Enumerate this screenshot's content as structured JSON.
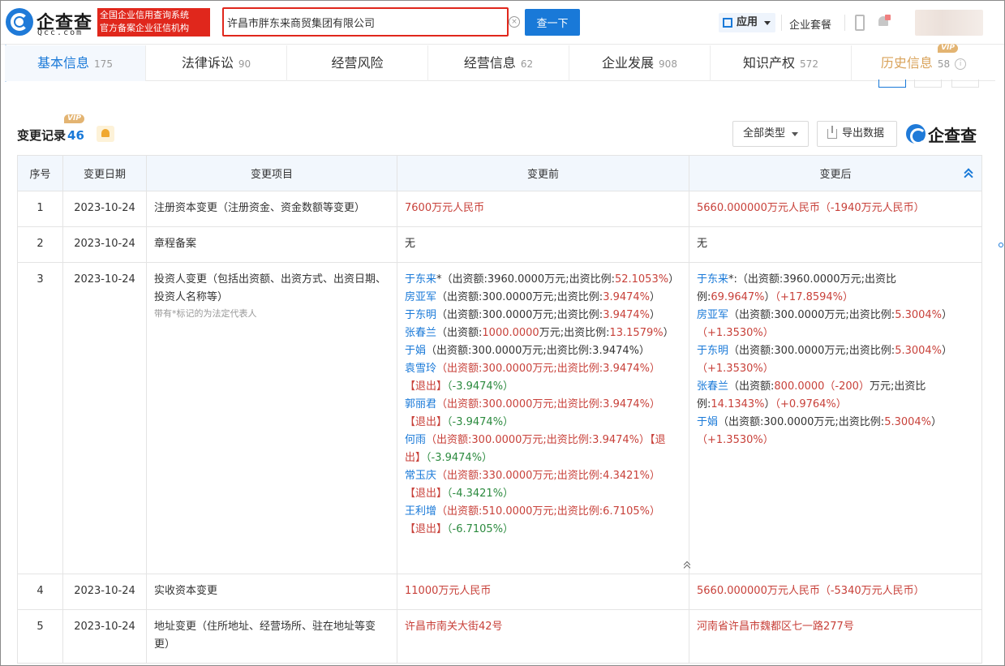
{
  "header": {
    "logo_name": "企查查",
    "logo_sub": "Qcc.com",
    "badge_line1": "全国企业信用查询系统",
    "badge_line2": "官方备案企业征信机构",
    "search_value": "许昌市胖东来商贸集团有限公司",
    "search_button": "查一下",
    "clear_symbol": "×",
    "apps_label": "应用",
    "packages_label": "企业套餐"
  },
  "tabs": [
    {
      "label": "基本信息",
      "count": "175"
    },
    {
      "label": "法律诉讼",
      "count": "90"
    },
    {
      "label": "经营风险",
      "count": ""
    },
    {
      "label": "经营信息",
      "count": "62"
    },
    {
      "label": "企业发展",
      "count": "908"
    },
    {
      "label": "知识产权",
      "count": "572"
    },
    {
      "label": "历史信息",
      "count": "58",
      "vip": "VIP",
      "info": "i"
    }
  ],
  "section": {
    "title": "变更记录",
    "count": "46",
    "vip": "VIP",
    "type_filter": "全部类型",
    "export": "导出数据",
    "brand": "企查查"
  },
  "table": {
    "headers": [
      "序号",
      "变更日期",
      "变更项目",
      "变更前",
      "变更后"
    ],
    "rows": [
      {
        "no": "1",
        "date": "2023-10-24",
        "item": "注册资本变更（注册资金、资金数额等变更）",
        "before": "7600万元人民币",
        "after": "5660.000000万元人民币（-1940万元人民币）"
      },
      {
        "no": "2",
        "date": "2023-10-24",
        "item": "章程备案",
        "before": "无",
        "after": "无"
      },
      {
        "no": "3",
        "date": "2023-10-24",
        "item": "投资人变更（包括出资额、出资方式、出资日期、投资人名称等）",
        "note": "带有*标记的为法定代表人",
        "before": {
          "p1_name": "于东来",
          "p1_a": "*（出资额:3960.0000万元;出资比例:",
          "p1_b": "52.1053%",
          "p1_c": "）",
          "p2_name": "房亚军",
          "p2_a": "（出资额:300.0000万元;出资比例:",
          "p2_b": "3.9474%",
          "p2_c": "）",
          "p3_name": "于东明",
          "p3_a": "（出资额:300.0000万元;出资比例:",
          "p3_b": "3.9474%",
          "p3_c": "）",
          "p4_name": "张春兰",
          "p4_a": "（出资额:",
          "p4_b": "1000.0000",
          "p4_c": "万元;出资比例:",
          "p4_d": "13.1579%",
          "p4_e": "）",
          "p5_name": "于娟",
          "p5_a": "（出资额:300.0000万元;出资比例:3.9474%）",
          "p6_name": "袁雪玲",
          "p6_a": "（出资额:300.0000万元;出资比例:3.9474%）",
          "p6_exit": "【退出】",
          "p6_chg": "（-3.9474%）",
          "p7_name": "郭丽君",
          "p7_a": "（出资额:300.0000万元;出资比例:3.9474%）",
          "p7_exit": "【退出】",
          "p7_chg": "（-3.9474%）",
          "p8_name": "何雨",
          "p8_a": "（出资额:300.0000万元;出资比例:3.9474%）",
          "p8_exit": "【退出】",
          "p8_chg": "（-3.9474%）",
          "p9_name": "常玉庆",
          "p9_a": "（出资额:330.0000万元;出资比例:4.3421%）",
          "p9_exit": "【退出】",
          "p9_chg": "（-4.3421%）",
          "p10_name": "王利增",
          "p10_a": "（出资额:510.0000万元;出资比例:6.7105%）",
          "p10_exit": "【退出】",
          "p10_chg": "（-6.7105%）"
        },
        "after": {
          "p1_name": "于东来",
          "p1_a": "*:（出资额:3960.0000万元;出资比例:",
          "p1_b": "69.9647%",
          "p1_c": "）",
          "p1_chg": "（+17.8594%）",
          "p2_name": "房亚军",
          "p2_a": "（出资额:300.0000万元;出资比例:",
          "p2_b": "5.3004%",
          "p2_c": "）",
          "p2_chg": "（+1.3530%）",
          "p3_name": "于东明",
          "p3_a": "（出资额:300.0000万元;出资比例:",
          "p3_b": "5.3004%",
          "p3_c": "）",
          "p3_chg": "（+1.3530%）",
          "p4_name": "张春兰",
          "p4_a": "（出资额:",
          "p4_b": "800.0000（-200）",
          "p4_c": "万元;出资比例:",
          "p4_d": "14.1343%",
          "p4_e": "）",
          "p4_chg": "（+0.9764%）",
          "p5_name": "于娟",
          "p5_a": "（出资额:300.0000万元;出资比例:",
          "p5_b": "5.3004%",
          "p5_c": "）",
          "p5_chg": "（+1.3530%）"
        }
      },
      {
        "no": "4",
        "date": "2023-10-24",
        "item": "实收资本变更",
        "before": "11000万元人民币",
        "after": "5660.000000万元人民币（-5340万元人民币）"
      },
      {
        "no": "5",
        "date": "2023-10-24",
        "item": "地址变更（住所地址、经营场所、驻在地址等变更）",
        "before": "许昌市南关大街42号",
        "after": "河南省许昌市魏都区七一路277号"
      }
    ]
  },
  "colors": {
    "brand_blue": "#1979d8",
    "alert_red": "#e0271c",
    "value_red": "#c8413a",
    "change_green": "#2b8a3e",
    "vip_gold": "#e3b472"
  }
}
